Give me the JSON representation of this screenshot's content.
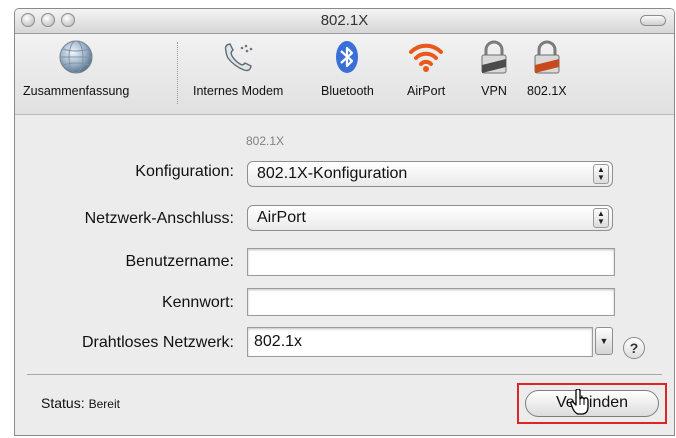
{
  "window": {
    "title": "802.1X"
  },
  "toolbar": {
    "items": [
      {
        "label": "Zusammenfassung",
        "icon": "globe-icon"
      },
      {
        "label": "Internes Modem",
        "icon": "phone-icon"
      },
      {
        "label": "Bluetooth",
        "icon": "bluetooth-icon"
      },
      {
        "label": "AirPort",
        "icon": "airport-icon"
      },
      {
        "label": "VPN",
        "icon": "lock-icon"
      },
      {
        "label": "802.1X",
        "icon": "lock-icon"
      }
    ]
  },
  "form": {
    "section_label": "802.1X",
    "konfiguration": {
      "label": "Konfiguration:",
      "value": "802.1X-Konfiguration"
    },
    "netzwerk": {
      "label": "Netzwerk-Anschluss:",
      "value": "AirPort"
    },
    "benutzername": {
      "label": "Benutzername:",
      "value": ""
    },
    "kennwort": {
      "label": "Kennwort:",
      "value": ""
    },
    "drahtlos": {
      "label": "Drahtloses Netzwerk:",
      "value": "802.1x"
    }
  },
  "status": {
    "label": "Status:",
    "value": "Bereit"
  },
  "buttons": {
    "connect": "Verbinden",
    "help": "?"
  },
  "colors": {
    "highlight_border": "#e02525",
    "bluetooth": "#3a6fd8",
    "airport": "#e8591a"
  }
}
